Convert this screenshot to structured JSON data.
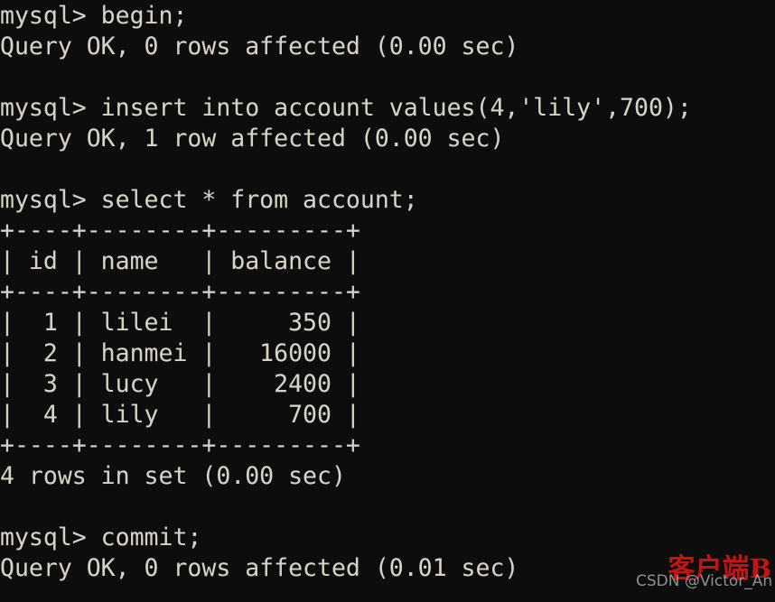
{
  "terminal": {
    "background_color": "#0d0d0d",
    "text_color": "#d6d2c8",
    "prompt": "mysql>",
    "lines": [
      "mysql> begin;",
      "Query OK, 0 rows affected (0.00 sec)",
      "",
      "mysql> insert into account values(4,'lily',700);",
      "Query OK, 1 row affected (0.00 sec)",
      "",
      "mysql> select * from account;",
      "+----+--------+---------+",
      "| id | name   | balance |",
      "+----+--------+---------+",
      "|  1 | lilei  |     350 |",
      "|  2 | hanmei |   16000 |",
      "|  3 | lucy   |    2400 |",
      "|  4 | lily   |     700 |",
      "+----+--------+---------+",
      "4 rows in set (0.00 sec)",
      "",
      "mysql> commit;",
      "Query OK, 0 rows affected (0.01 sec)"
    ],
    "commands": [
      {
        "prompt": "mysql>",
        "sql": "begin;",
        "result": "Query OK, 0 rows affected (0.00 sec)"
      },
      {
        "prompt": "mysql>",
        "sql": "insert into account values(4,'lily',700);",
        "result": "Query OK, 1 row affected (0.00 sec)"
      },
      {
        "prompt": "mysql>",
        "sql": "select * from account;",
        "result": "4 rows in set (0.00 sec)"
      },
      {
        "prompt": "mysql>",
        "sql": "commit;",
        "result": "Query OK, 0 rows affected (0.01 sec)"
      }
    ],
    "result_table": {
      "columns": [
        "id",
        "name",
        "balance"
      ],
      "rows": [
        [
          "1",
          "lilei",
          "350"
        ],
        [
          "2",
          "hanmei",
          "16000"
        ],
        [
          "3",
          "lucy",
          "2400"
        ],
        [
          "4",
          "lily",
          "700"
        ]
      ],
      "row_count_text": "4 rows in set (0.00 sec)",
      "separator": "+----+--------+---------+"
    }
  },
  "watermark": {
    "chinese_text": "客户端",
    "chinese_suffix": "B",
    "chinese_color": "#c01515",
    "csdn_text": "CSDN @Victor_An",
    "csdn_color": "#9b9b9b"
  }
}
